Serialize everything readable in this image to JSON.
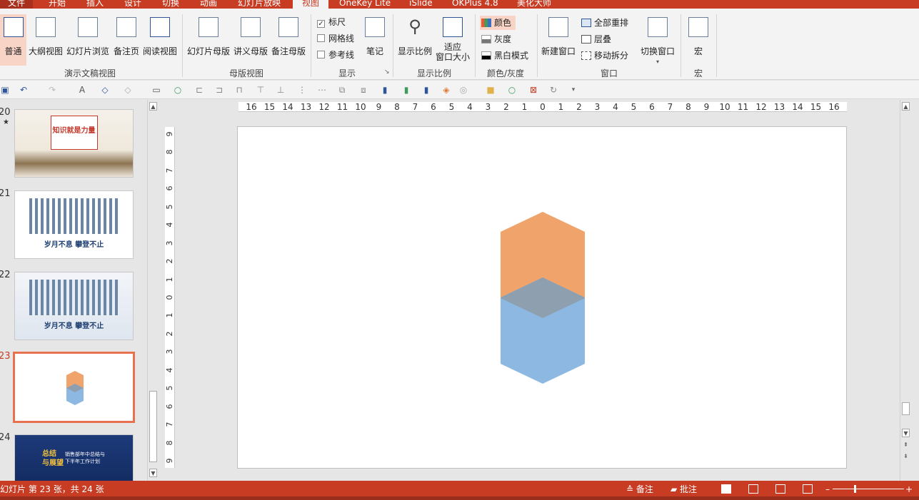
{
  "tabs": [
    "文件",
    "开始",
    "插入",
    "设计",
    "切换",
    "动画",
    "幻灯片放映",
    "视图",
    "OneKey Lite",
    "iSlide",
    "OKPlus 4.8",
    "美化大师"
  ],
  "active_tab": "视图",
  "ribbon": {
    "presentation_views": {
      "label": "演示文稿视图",
      "buttons": [
        "普通",
        "大纲视图",
        "幻灯片浏览",
        "备注页",
        "阅读视图"
      ]
    },
    "master_views": {
      "label": "母版视图",
      "buttons": [
        "幻灯片母版",
        "讲义母版",
        "备注母版"
      ]
    },
    "show": {
      "label": "显示",
      "checks": [
        {
          "label": "标尺",
          "checked": true
        },
        {
          "label": "网格线",
          "checked": false
        },
        {
          "label": "参考线",
          "checked": false
        }
      ],
      "notes": "笔记"
    },
    "zoom": {
      "label": "显示比例",
      "buttons": [
        "显示比例",
        "适应\n窗口大小"
      ]
    },
    "color": {
      "label": "颜色/灰度",
      "options": [
        "颜色",
        "灰度",
        "黑白模式"
      ]
    },
    "window": {
      "label": "窗口",
      "new_window": "新建窗口",
      "options": [
        "全部重排",
        "层叠",
        "移动拆分"
      ],
      "switch": "切换窗口"
    },
    "macro": {
      "label": "宏",
      "button": "宏"
    }
  },
  "thumbnails": [
    {
      "num": "20",
      "star": "★",
      "title": "知识就是力量",
      "subtitle": "",
      "selected": false
    },
    {
      "num": "21",
      "title": "岁月不息  攀登不止",
      "selected": false
    },
    {
      "num": "22",
      "title": "岁月不息  攀登不止",
      "selected": false
    },
    {
      "num": "23",
      "title": "",
      "selected": true
    },
    {
      "num": "24",
      "title": "总结\n与展望",
      "subtitle": "销售部年中总结与\n下半年工作计划",
      "selected": false
    }
  ],
  "ruler": {
    "h": [
      "16",
      "15",
      "14",
      "13",
      "12",
      "11",
      "10",
      "9",
      "8",
      "7",
      "6",
      "5",
      "4",
      "3",
      "2",
      "1",
      "0",
      "1",
      "2",
      "3",
      "4",
      "5",
      "6",
      "7",
      "8",
      "9",
      "10",
      "11",
      "12",
      "13",
      "14",
      "15",
      "16"
    ],
    "v": [
      "9",
      "8",
      "7",
      "6",
      "5",
      "4",
      "3",
      "2",
      "1",
      "0",
      "1",
      "2",
      "3",
      "4",
      "5",
      "6",
      "7",
      "8",
      "9"
    ]
  },
  "colors": {
    "accent": "#c83c24",
    "hex_top": "#f0a46c",
    "hex_bottom": "#8db8e1",
    "overlap": "#8e9fb0"
  },
  "status": {
    "slide_info": "幻灯片 第 23 张，共 24 张",
    "notes": "备注",
    "comments": "批注"
  }
}
